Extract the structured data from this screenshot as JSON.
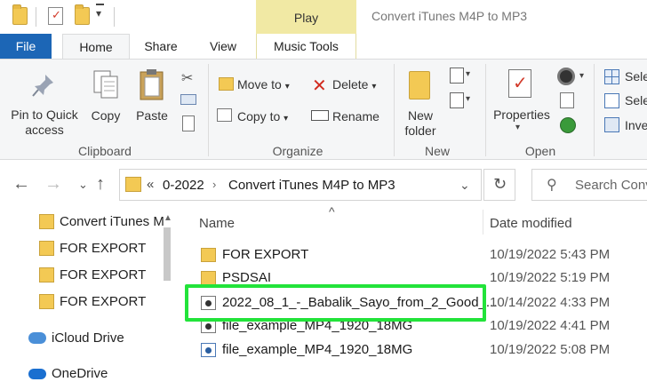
{
  "titlebar": {
    "context_tab": "Play",
    "window_title": "Convert iTunes M4P to MP3"
  },
  "tabs": [
    {
      "label": "File"
    },
    {
      "label": "Home"
    },
    {
      "label": "Share"
    },
    {
      "label": "View"
    },
    {
      "label": "Music Tools"
    }
  ],
  "ribbon": {
    "clipboard": {
      "pin_label": "Pin to Quick\naccess",
      "copy_label": "Copy",
      "paste_label": "Paste",
      "group_label": "Clipboard"
    },
    "organize": {
      "move_to": "Move to",
      "copy_to": "Copy to",
      "delete": "Delete",
      "rename": "Rename",
      "group_label": "Organize"
    },
    "new": {
      "new_folder": "New\nfolder",
      "group_label": "New"
    },
    "open": {
      "properties": "Properties",
      "group_label": "Open"
    },
    "select": {
      "select_all": "Sele",
      "select_none": "Sele",
      "invert": "Inve"
    }
  },
  "address": {
    "prefix": "«",
    "crumbs": [
      "0-2022",
      "Convert iTunes M4P to MP3"
    ],
    "search_placeholder": "Search Conv"
  },
  "nav": [
    {
      "label": "Convert iTunes M",
      "icon": "folder-icon"
    },
    {
      "label": "FOR EXPORT",
      "icon": "folder-icon"
    },
    {
      "label": "FOR EXPORT",
      "icon": "folder-icon"
    },
    {
      "label": "FOR EXPORT",
      "icon": "folder-icon"
    },
    {
      "label": "iCloud Drive",
      "icon": "icloud-icon"
    },
    {
      "label": "OneDrive",
      "icon": "onedrive-icon"
    }
  ],
  "list": {
    "col_name": "Name",
    "col_date": "Date modified",
    "rows": [
      {
        "name": "FOR EXPORT",
        "date": "10/19/2022 5:43 PM",
        "icon": "folder-icon"
      },
      {
        "name": "PSDSAI",
        "date": "10/19/2022 5:19 PM",
        "icon": "folder-icon"
      },
      {
        "name": "2022_08_1_-_Babalik_Sayo_from_2_Good_...",
        "date": "10/14/2022 4:33 PM",
        "icon": "audio-file-icon"
      },
      {
        "name": "file_example_MP4_1920_18MG",
        "date": "10/19/2022 4:41 PM",
        "icon": "video-file-icon"
      },
      {
        "name": "file_example_MP4_1920_18MG",
        "date": "10/19/2022 5:08 PM",
        "icon": "video-file-icon"
      }
    ]
  },
  "colors": {
    "file_tab": "#1c66b6",
    "play_tab": "#f1e9a4",
    "highlight": "#22e33a",
    "folder": "#f3c954"
  }
}
